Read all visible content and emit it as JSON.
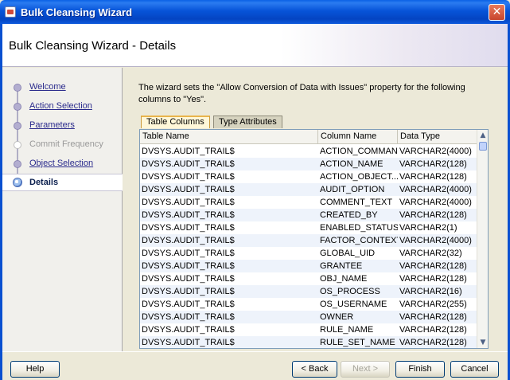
{
  "window": {
    "title": "Bulk Cleansing Wizard",
    "close_glyph": "✕"
  },
  "header": {
    "title": "Bulk Cleansing Wizard - Details"
  },
  "nav": {
    "items": [
      {
        "label": "Welcome",
        "state": "link"
      },
      {
        "label": "Action Selection",
        "state": "link"
      },
      {
        "label": "Parameters",
        "state": "link"
      },
      {
        "label": "Commit Frequency",
        "state": "disabled"
      },
      {
        "label": "Object Selection",
        "state": "link"
      },
      {
        "label": "Details",
        "state": "active"
      }
    ]
  },
  "main": {
    "description": "The wizard sets the \"Allow Conversion of Data with Issues\" property for the following columns to \"Yes\".",
    "tabs": [
      {
        "label": "Table Columns",
        "active": true
      },
      {
        "label": "Type Attributes",
        "active": false
      }
    ],
    "table": {
      "headers": [
        "Table Name",
        "Column Name",
        "Data Type"
      ],
      "rows": [
        [
          "DVSYS.AUDIT_TRAIL$",
          "ACTION_COMMAND",
          "VARCHAR2(4000)"
        ],
        [
          "DVSYS.AUDIT_TRAIL$",
          "ACTION_NAME",
          "VARCHAR2(128)"
        ],
        [
          "DVSYS.AUDIT_TRAIL$",
          "ACTION_OBJECT...",
          "VARCHAR2(128)"
        ],
        [
          "DVSYS.AUDIT_TRAIL$",
          "AUDIT_OPTION",
          "VARCHAR2(4000)"
        ],
        [
          "DVSYS.AUDIT_TRAIL$",
          "COMMENT_TEXT",
          "VARCHAR2(4000)"
        ],
        [
          "DVSYS.AUDIT_TRAIL$",
          "CREATED_BY",
          "VARCHAR2(128)"
        ],
        [
          "DVSYS.AUDIT_TRAIL$",
          "ENABLED_STATUS",
          "VARCHAR2(1)"
        ],
        [
          "DVSYS.AUDIT_TRAIL$",
          "FACTOR_CONTEXT",
          "VARCHAR2(4000)"
        ],
        [
          "DVSYS.AUDIT_TRAIL$",
          "GLOBAL_UID",
          "VARCHAR2(32)"
        ],
        [
          "DVSYS.AUDIT_TRAIL$",
          "GRANTEE",
          "VARCHAR2(128)"
        ],
        [
          "DVSYS.AUDIT_TRAIL$",
          "OBJ_NAME",
          "VARCHAR2(128)"
        ],
        [
          "DVSYS.AUDIT_TRAIL$",
          "OS_PROCESS",
          "VARCHAR2(16)"
        ],
        [
          "DVSYS.AUDIT_TRAIL$",
          "OS_USERNAME",
          "VARCHAR2(255)"
        ],
        [
          "DVSYS.AUDIT_TRAIL$",
          "OWNER",
          "VARCHAR2(128)"
        ],
        [
          "DVSYS.AUDIT_TRAIL$",
          "RULE_NAME",
          "VARCHAR2(128)"
        ],
        [
          "DVSYS.AUDIT_TRAIL$",
          "RULE_SET_NAME",
          "VARCHAR2(128)"
        ]
      ]
    }
  },
  "footer": {
    "help": "Help",
    "back": "< Back",
    "next": "Next >",
    "finish": "Finish",
    "cancel": "Cancel"
  },
  "colors": {
    "title_bar": "#0754d8",
    "link": "#2a2a8c",
    "active_tab": "#fff7d8"
  }
}
